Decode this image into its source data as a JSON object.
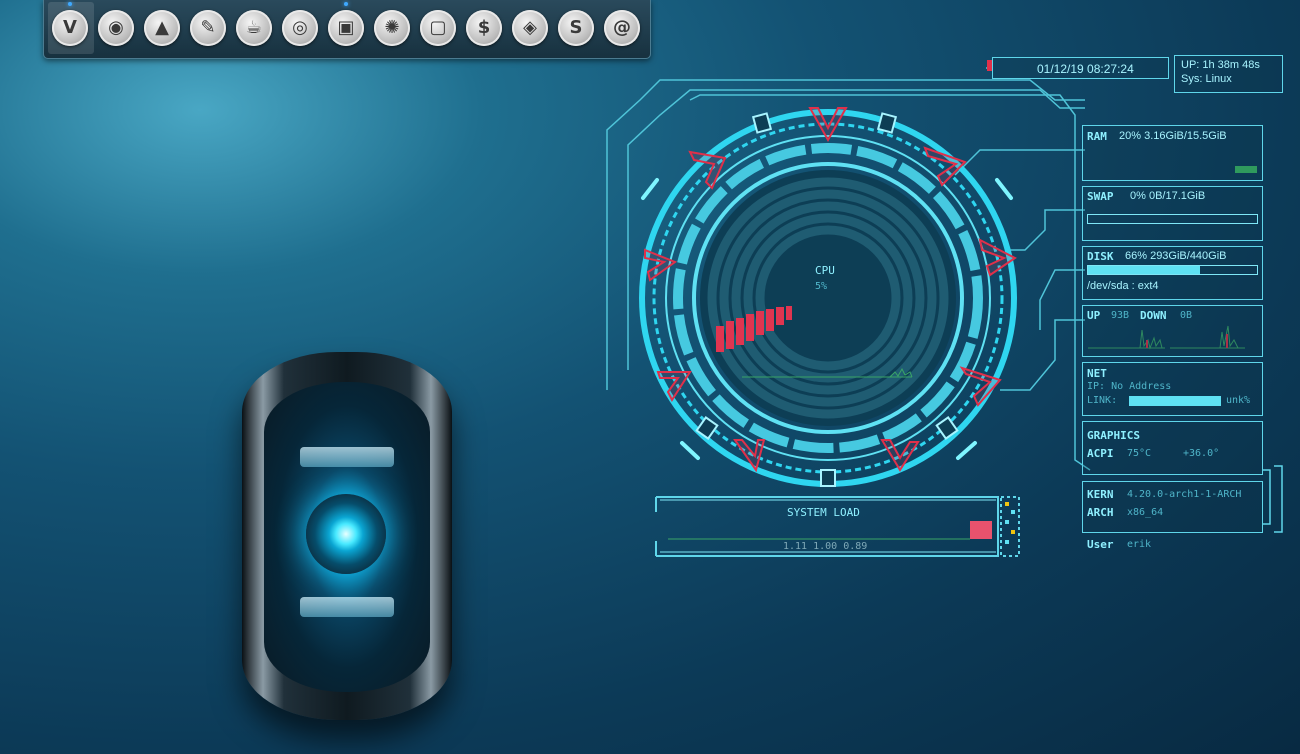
{
  "dock": {
    "items": [
      {
        "name": "vivaldi-icon",
        "glyph": "V"
      },
      {
        "name": "firefox-icon",
        "glyph": "◉"
      },
      {
        "name": "inkscape-icon",
        "glyph": "▲"
      },
      {
        "name": "gimp-icon",
        "glyph": "✎"
      },
      {
        "name": "teapot-icon",
        "glyph": "☕"
      },
      {
        "name": "chrome-icon",
        "glyph": "◎"
      },
      {
        "name": "file-manager-icon",
        "glyph": "▣"
      },
      {
        "name": "camera-aperture-icon",
        "glyph": "✺"
      },
      {
        "name": "window-icon",
        "glyph": "▢"
      },
      {
        "name": "terminal-icon",
        "glyph": "$"
      },
      {
        "name": "screenshot-icon",
        "glyph": "◈"
      },
      {
        "name": "s-app-icon",
        "glyph": "S"
      },
      {
        "name": "debian-swirl-icon",
        "glyph": "@"
      }
    ]
  },
  "header": {
    "datetime": "01/12/19 08:27:24",
    "uptime": "UP: 1h 38m 48s",
    "sys": "Sys: Linux"
  },
  "cpu": {
    "label": "CPU",
    "percent": "5%"
  },
  "ram": {
    "label": "RAM",
    "value": "20% 3.16GiB/15.5GiB",
    "fill": 0.2
  },
  "swap": {
    "label": "SWAP",
    "value": "0% 0B/17.1GiB",
    "fill": 0.0
  },
  "disk": {
    "label": "DISK",
    "value": "66% 293GiB/440GiB",
    "fill": 0.66,
    "device": "/dev/sda : ext4"
  },
  "network": {
    "up_label": "UP",
    "up_value": "93B",
    "down_label": "DOWN",
    "down_value": "0B"
  },
  "net": {
    "label": "NET",
    "ip": "IP: No Address",
    "link_label": "LINK:",
    "link_value": "unk%"
  },
  "graphics": {
    "label": "GRAPHICS",
    "acpi_label": "ACPI",
    "acpi_temp": "75°C",
    "acpi_temp2": "+36.0°"
  },
  "kernel": {
    "kern_label": "KERN",
    "kern_value": "4.20.0-arch1-1-ARCH",
    "arch_label": "ARCH",
    "arch_value": "x86_64",
    "user_label": "User",
    "user_value": "erik"
  },
  "system_load": {
    "label": "SYSTEM LOAD",
    "values": "1.11 1.00 0.89"
  },
  "colors": {
    "accent": "#5fd6ea",
    "warn": "#e0304a"
  }
}
